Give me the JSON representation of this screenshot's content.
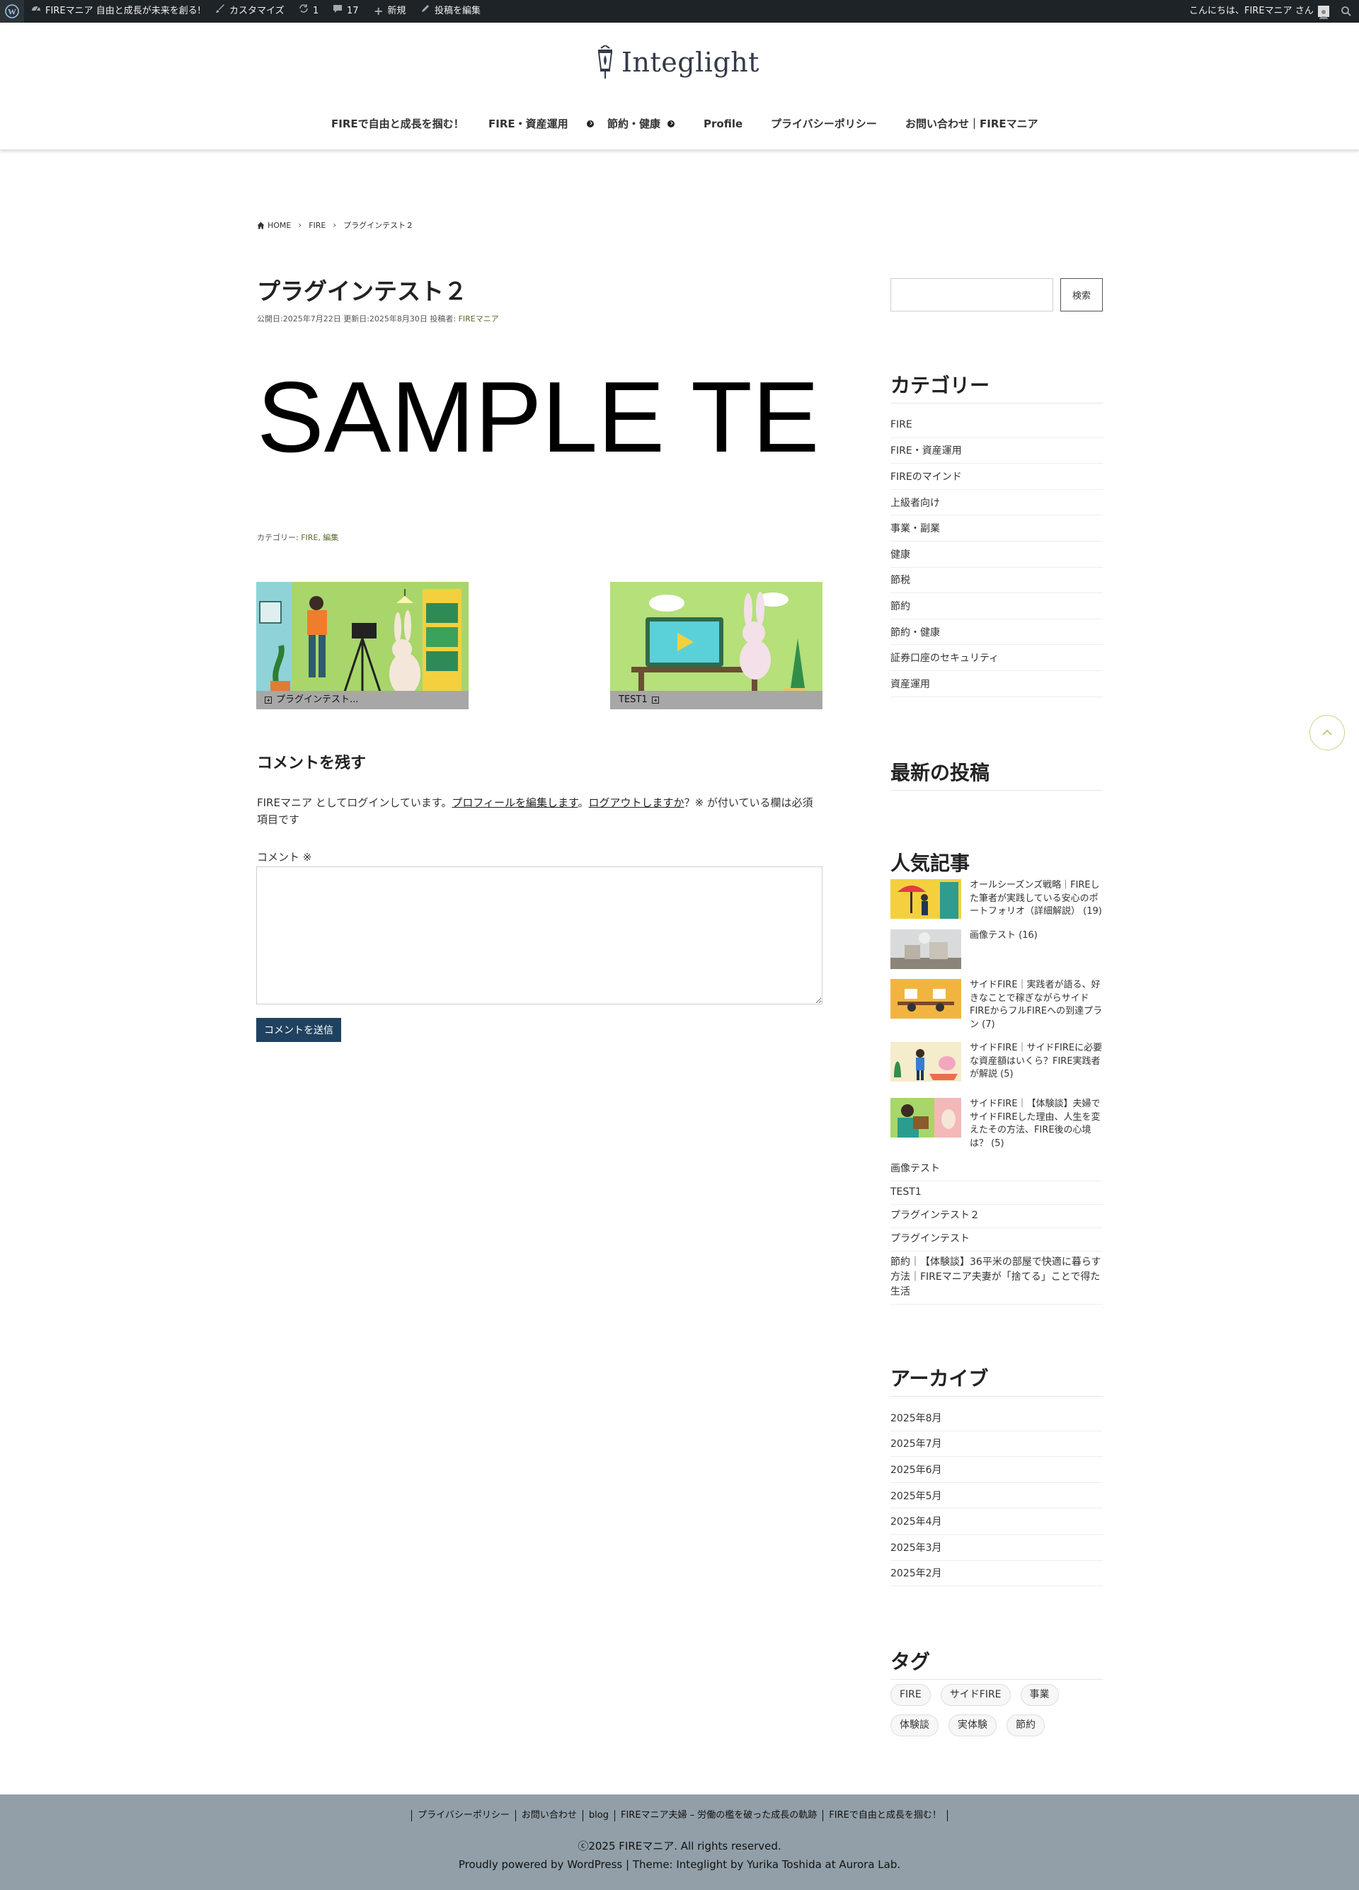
{
  "adminbar": {
    "site_name": "FIREマニア 自由と成長が未来を創る!",
    "customize": "カスタマイズ",
    "updates_count": "1",
    "comments_count": "17",
    "new_label": "新規",
    "edit_post": "投稿を編集",
    "greeting": "こんにちは、FIREマニア さん"
  },
  "header": {
    "logo_text": "Integlight",
    "nav": [
      {
        "label": "FIREで自由と成長を掴む！"
      },
      {
        "label": "FIRE・資産運用"
      },
      {
        "label": "節約・健康"
      },
      {
        "label": "Profile"
      },
      {
        "label": "プライバシーポリシー"
      },
      {
        "label": "お問い合わせ｜FIREマニア"
      }
    ]
  },
  "breadcrumb": {
    "home": "HOME",
    "category": "FIRE",
    "current": "プラグインテスト２"
  },
  "post": {
    "title": "プラグインテスト２",
    "meta_prefix": "公開日:2025年7月22日 更新日:2025年8月30日 投稿者: ",
    "author": "FIREマニア",
    "sample_text": "SAMPLE TE",
    "cats_prefix": "カテゴリー: ",
    "cats": "FIRE, 編集"
  },
  "related": [
    {
      "label": "プラグインテスト..."
    },
    {
      "label": "TEST1"
    }
  ],
  "comments": {
    "heading": "コメントを残す",
    "logged_in_prefix": "FIREマニア としてログインしています。",
    "edit_profile": "プロフィールを編集します",
    "sep": "。",
    "logout": "ログアウトしますか",
    "required_note": "？※ が付いている欄は必須項目です",
    "comment_label": "コメント ※",
    "submit": "コメントを送信"
  },
  "sidebar": {
    "search_button": "検索",
    "categories_title": "カテゴリー",
    "categories": [
      "FIRE",
      "FIRE・資産運用",
      "FIREのマインド",
      "上級者向け",
      "事業・副業",
      "健康",
      "節税",
      "節約",
      "節約・健康",
      "証券口座のセキュリティ",
      "資産運用"
    ],
    "recent_title": "最新の投稿",
    "popular_title": "人気記事",
    "popular": [
      {
        "text": "オールシーズンズ戦略｜FIREした筆者が実践している安心のポートフォリオ（詳細解説） (19)"
      },
      {
        "text": "画像テスト (16)"
      },
      {
        "text": "サイドFIRE｜実践者が語る、好きなことで稼ぎながらサイドFIREからフルFIREへの到達プラン (7)"
      },
      {
        "text": "サイドFIRE｜サイドFIREに必要な資産額はいくら？FIRE実践者が解説 (5)"
      },
      {
        "text": "サイドFIRE｜【体験談】夫婦でサイドFIREした理由、人生を変えたその方法、FIRE後の心境は？ (5)"
      }
    ],
    "popular_list": [
      "画像テスト",
      "TEST1",
      "プラグインテスト２",
      "プラグインテスト",
      "節約｜【体験談】36平米の部屋で快適に暮らす方法｜FIREマニア夫妻が「捨てる」ことで得た生活"
    ],
    "archive_title": "アーカイブ",
    "archives": [
      "2025年8月",
      "2025年7月",
      "2025年6月",
      "2025年5月",
      "2025年4月",
      "2025年3月",
      "2025年2月"
    ],
    "tags_title": "タグ",
    "tags": [
      "FIRE",
      "サイドFIRE",
      "事業",
      "体験談",
      "実体験",
      "節約"
    ]
  },
  "footer": {
    "nav": [
      "プライバシーポリシー",
      "お問い合わせ",
      "blog",
      "FIREマニア夫婦 – 労働の檻を破った成長の軌跡",
      "FIREで自由と成長を掴む！"
    ],
    "copyright": "ⓒ2025 FIREマニア. All rights reserved.",
    "powered": "Proudly powered by WordPress | Theme: Integlight by Yurika Toshida at Aurora Lab."
  }
}
